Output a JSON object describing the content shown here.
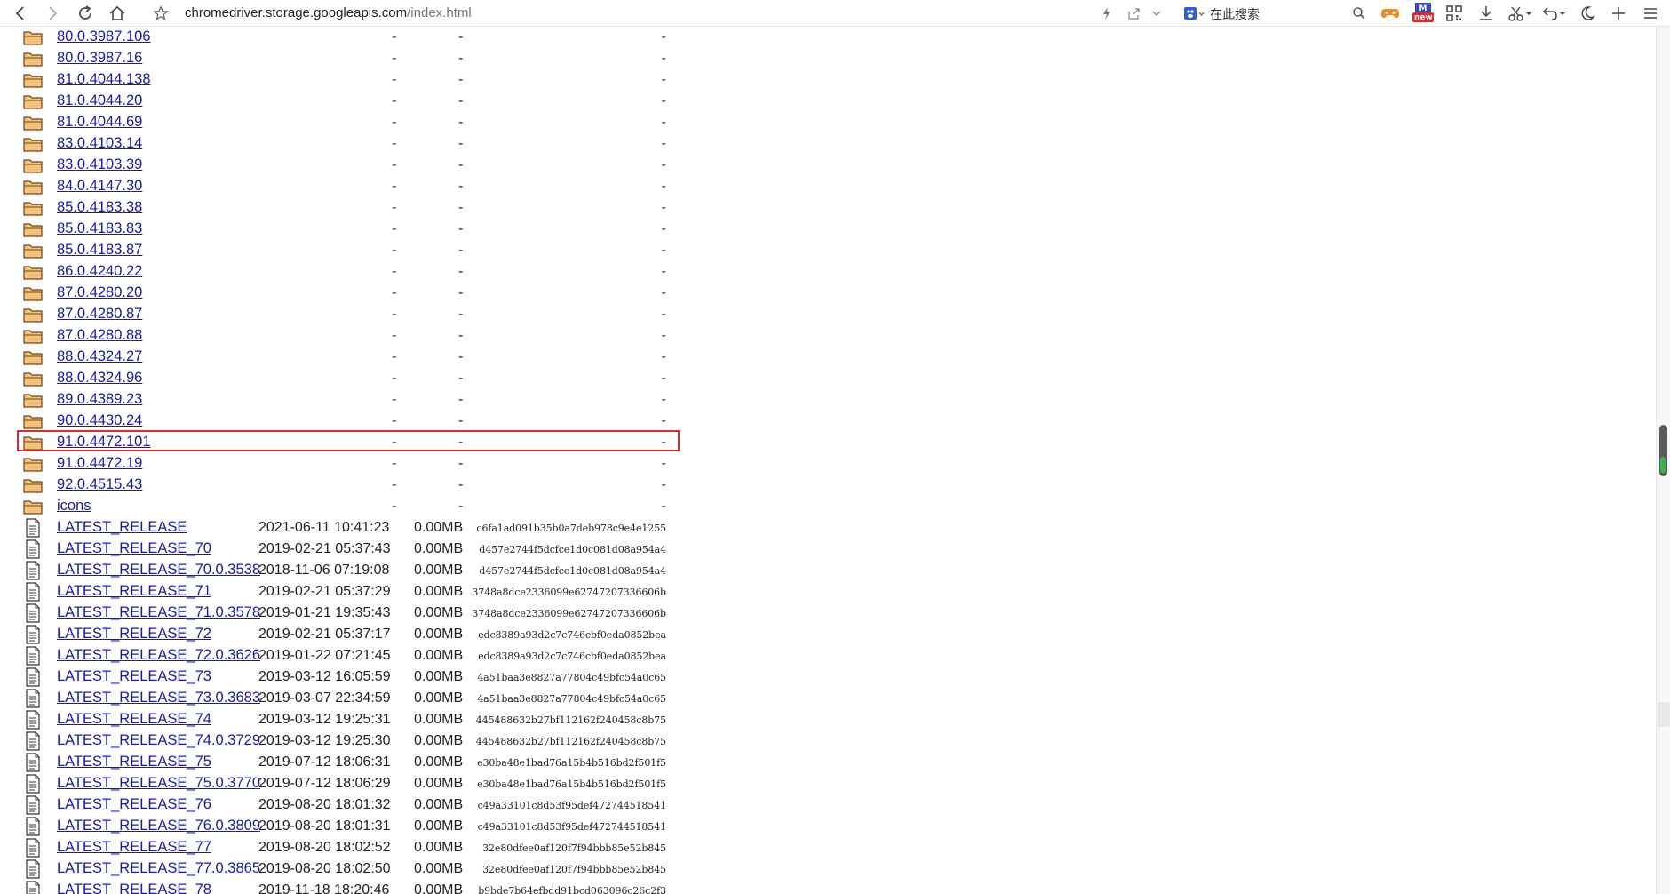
{
  "toolbar": {
    "url_host": "chromedriver.storage.googleapis.com",
    "url_path": "/index.html",
    "search_placeholder": "在此搜索",
    "new_badge": "new",
    "icons": [
      "back-icon",
      "forward-icon",
      "reload-icon",
      "home-icon",
      "star-icon",
      "lightning-icon",
      "share-icon",
      "chevron-down-icon",
      "search-engine-icon",
      "search-icon",
      "game-icon",
      "news-icon",
      "qr-code-icon",
      "download-icon",
      "scissors-icon",
      "undo-icon",
      "moon-icon",
      "new-tab-icon",
      "menu-icon"
    ]
  },
  "listing": {
    "folders": [
      {
        "name": "80.0.3987.106",
        "date": "-",
        "size": "-",
        "hash": "-"
      },
      {
        "name": "80.0.3987.16",
        "date": "-",
        "size": "-",
        "hash": "-"
      },
      {
        "name": "81.0.4044.138",
        "date": "-",
        "size": "-",
        "hash": "-"
      },
      {
        "name": "81.0.4044.20",
        "date": "-",
        "size": "-",
        "hash": "-"
      },
      {
        "name": "81.0.4044.69",
        "date": "-",
        "size": "-",
        "hash": "-"
      },
      {
        "name": "83.0.4103.14",
        "date": "-",
        "size": "-",
        "hash": "-"
      },
      {
        "name": "83.0.4103.39",
        "date": "-",
        "size": "-",
        "hash": "-"
      },
      {
        "name": "84.0.4147.30",
        "date": "-",
        "size": "-",
        "hash": "-"
      },
      {
        "name": "85.0.4183.38",
        "date": "-",
        "size": "-",
        "hash": "-"
      },
      {
        "name": "85.0.4183.83",
        "date": "-",
        "size": "-",
        "hash": "-"
      },
      {
        "name": "85.0.4183.87",
        "date": "-",
        "size": "-",
        "hash": "-"
      },
      {
        "name": "86.0.4240.22",
        "date": "-",
        "size": "-",
        "hash": "-"
      },
      {
        "name": "87.0.4280.20",
        "date": "-",
        "size": "-",
        "hash": "-"
      },
      {
        "name": "87.0.4280.87",
        "date": "-",
        "size": "-",
        "hash": "-"
      },
      {
        "name": "87.0.4280.88",
        "date": "-",
        "size": "-",
        "hash": "-"
      },
      {
        "name": "88.0.4324.27",
        "date": "-",
        "size": "-",
        "hash": "-"
      },
      {
        "name": "88.0.4324.96",
        "date": "-",
        "size": "-",
        "hash": "-"
      },
      {
        "name": "89.0.4389.23",
        "date": "-",
        "size": "-",
        "hash": "-"
      },
      {
        "name": "90.0.4430.24",
        "date": "-",
        "size": "-",
        "hash": "-"
      },
      {
        "name": "91.0.4472.101",
        "date": "-",
        "size": "-",
        "hash": "-",
        "highlighted": true
      },
      {
        "name": "91.0.4472.19",
        "date": "-",
        "size": "-",
        "hash": "-"
      },
      {
        "name": "92.0.4515.43",
        "date": "-",
        "size": "-",
        "hash": "-"
      },
      {
        "name": "icons",
        "date": "-",
        "size": "-",
        "hash": "-"
      }
    ],
    "files": [
      {
        "name": "LATEST_RELEASE",
        "date": "2021-06-11 10:41:23",
        "size": "0.00MB",
        "hash": "c6fa1ad091b35b0a7deb978c9e4e1255"
      },
      {
        "name": "LATEST_RELEASE_70",
        "date": "2019-02-21 05:37:43",
        "size": "0.00MB",
        "hash": "d457e2744f5dcfce1d0c081d08a954a4"
      },
      {
        "name": "LATEST_RELEASE_70.0.3538",
        "date": "2018-11-06 07:19:08",
        "size": "0.00MB",
        "hash": "d457e2744f5dcfce1d0c081d08a954a4"
      },
      {
        "name": "LATEST_RELEASE_71",
        "date": "2019-02-21 05:37:29",
        "size": "0.00MB",
        "hash": "3748a8dce2336099e62747207336606b"
      },
      {
        "name": "LATEST_RELEASE_71.0.3578",
        "date": "2019-01-21 19:35:43",
        "size": "0.00MB",
        "hash": "3748a8dce2336099e62747207336606b"
      },
      {
        "name": "LATEST_RELEASE_72",
        "date": "2019-02-21 05:37:17",
        "size": "0.00MB",
        "hash": "edc8389a93d2c7c746cbf0eda0852bea"
      },
      {
        "name": "LATEST_RELEASE_72.0.3626",
        "date": "2019-01-22 07:21:45",
        "size": "0.00MB",
        "hash": "edc8389a93d2c7c746cbf0eda0852bea"
      },
      {
        "name": "LATEST_RELEASE_73",
        "date": "2019-03-12 16:05:59",
        "size": "0.00MB",
        "hash": "4a51baa3e8827a77804c49bfc54a0c65"
      },
      {
        "name": "LATEST_RELEASE_73.0.3683",
        "date": "2019-03-07 22:34:59",
        "size": "0.00MB",
        "hash": "4a51baa3e8827a77804c49bfc54a0c65"
      },
      {
        "name": "LATEST_RELEASE_74",
        "date": "2019-03-12 19:25:31",
        "size": "0.00MB",
        "hash": "445488632b27bf112162f240458c8b75"
      },
      {
        "name": "LATEST_RELEASE_74.0.3729",
        "date": "2019-03-12 19:25:30",
        "size": "0.00MB",
        "hash": "445488632b27bf112162f240458c8b75"
      },
      {
        "name": "LATEST_RELEASE_75",
        "date": "2019-07-12 18:06:31",
        "size": "0.00MB",
        "hash": "e30ba48e1bad76a15b4b516bd2f501f5"
      },
      {
        "name": "LATEST_RELEASE_75.0.3770",
        "date": "2019-07-12 18:06:29",
        "size": "0.00MB",
        "hash": "e30ba48e1bad76a15b4b516bd2f501f5"
      },
      {
        "name": "LATEST_RELEASE_76",
        "date": "2019-08-20 18:01:32",
        "size": "0.00MB",
        "hash": "c49a33101c8d53f95def472744518541"
      },
      {
        "name": "LATEST_RELEASE_76.0.3809",
        "date": "2019-08-20 18:01:31",
        "size": "0.00MB",
        "hash": "c49a33101c8d53f95def472744518541"
      },
      {
        "name": "LATEST_RELEASE_77",
        "date": "2019-08-20 18:02:52",
        "size": "0.00MB",
        "hash": "32e80dfee0af120f7f94bbb85e52b845"
      },
      {
        "name": "LATEST_RELEASE_77.0.3865",
        "date": "2019-08-20 18:02:50",
        "size": "0.00MB",
        "hash": "32e80dfee0af120f7f94bbb85e52b845"
      },
      {
        "name": "LATEST_RELEASE_78",
        "date": "2019-11-18 18:20:46",
        "size": "0.00MB",
        "hash": "b9bde7b64efbdd91bcd063096c26c2f3"
      }
    ]
  },
  "colors": {
    "link": "#1a1aa8",
    "highlight_border": "#e0282b",
    "folder_fill": "#f6c07a",
    "folder_stroke": "#6b4a1a"
  }
}
